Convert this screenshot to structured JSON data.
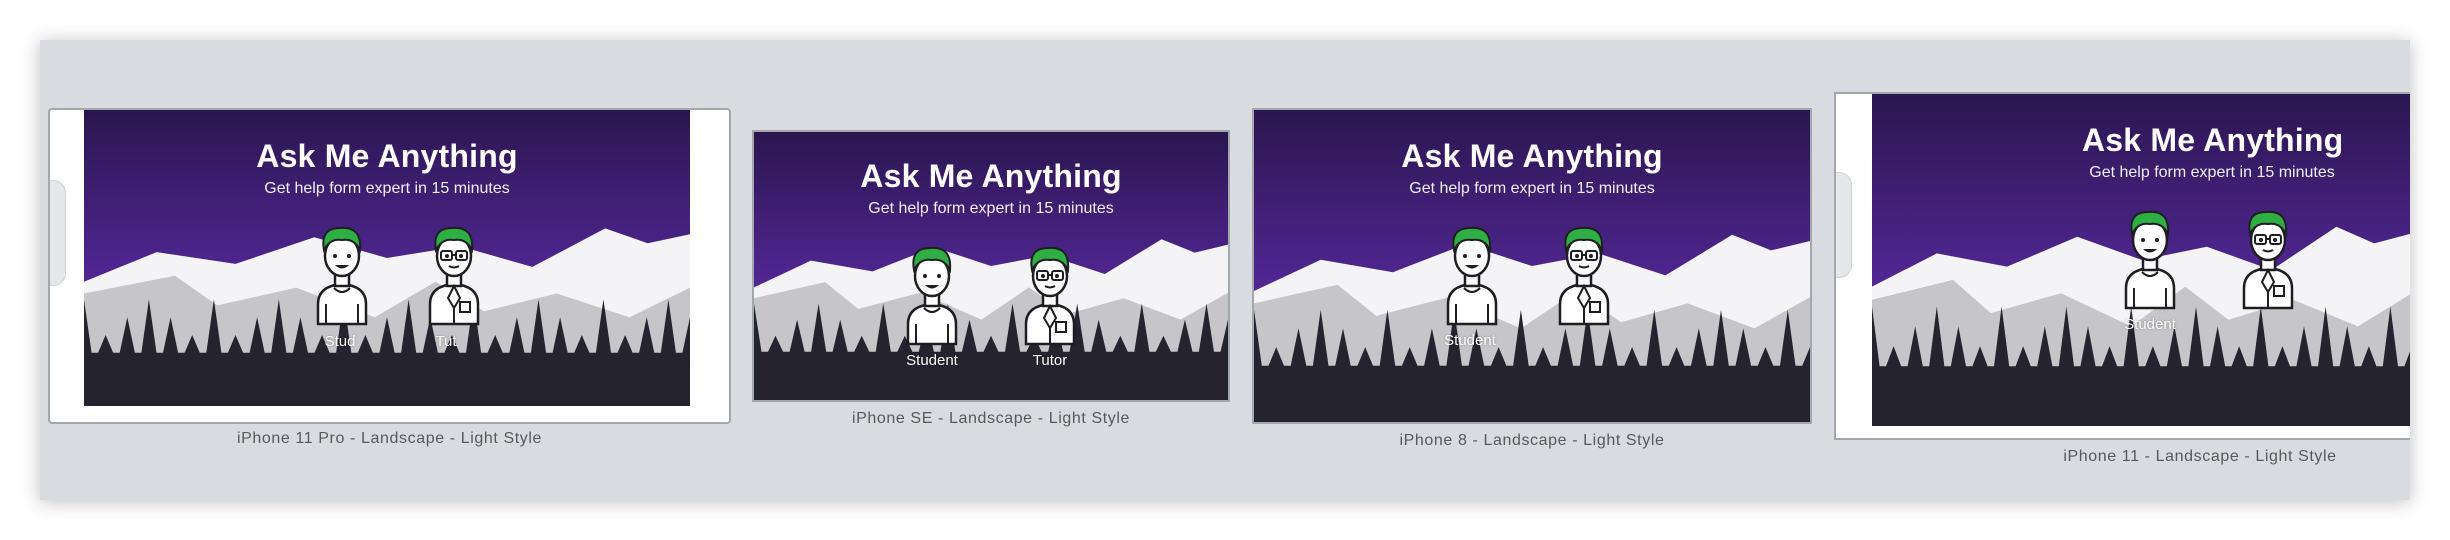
{
  "colors": {
    "canvas": "#d8dbdf",
    "sky_top": "#2b1650",
    "sky_bottom": "#5a2aa3",
    "snow": "#f4f4f6",
    "snow_shadow": "#bdbdc2",
    "forest": "#25232e",
    "hair": "#2fae43",
    "bezel": "#ffffff",
    "frame_border": "#a3a6aa"
  },
  "app": {
    "title": "Ask Me Anything",
    "subtitle": "Get help form expert in 15 minutes",
    "student_label": "Student",
    "tutor_label": "Tutor"
  },
  "artboards": [
    {
      "device": "iPhone 11 Pro",
      "caption": "iPhone 11 Pro - Landscape - Light Style",
      "student_label_visible": "Stud",
      "tutor_label_visible": "Tut"
    },
    {
      "device": "iPhone SE",
      "caption": "iPhone SE - Landscape - Light Style",
      "student_label_visible": "Student",
      "tutor_label_visible": "Tutor"
    },
    {
      "device": "iPhone 8",
      "caption": "iPhone 8 - Landscape - Light Style",
      "student_label_visible": "Student",
      "tutor_label_visible": ""
    },
    {
      "device": "iPhone 11",
      "caption": "iPhone 11 - Landscape - Light Style",
      "student_label_visible": "Student",
      "tutor_label_visible": ""
    }
  ]
}
